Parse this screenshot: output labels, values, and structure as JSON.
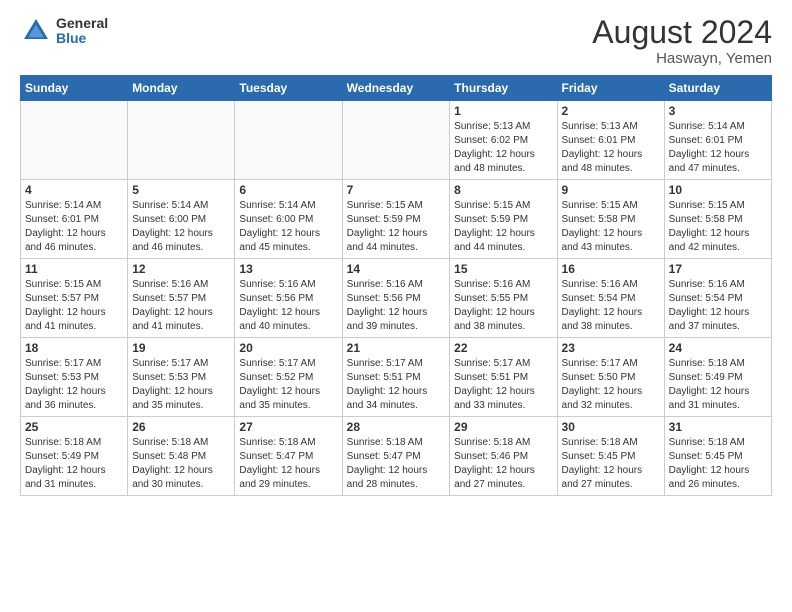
{
  "header": {
    "logo_general": "General",
    "logo_blue": "Blue",
    "main_title": "August 2024",
    "subtitle": "Haswayn, Yemen"
  },
  "calendar": {
    "days_of_week": [
      "Sunday",
      "Monday",
      "Tuesday",
      "Wednesday",
      "Thursday",
      "Friday",
      "Saturday"
    ],
    "weeks": [
      [
        {
          "day": "",
          "info": ""
        },
        {
          "day": "",
          "info": ""
        },
        {
          "day": "",
          "info": ""
        },
        {
          "day": "",
          "info": ""
        },
        {
          "day": "1",
          "info": "Sunrise: 5:13 AM\nSunset: 6:02 PM\nDaylight: 12 hours and 48 minutes."
        },
        {
          "day": "2",
          "info": "Sunrise: 5:13 AM\nSunset: 6:01 PM\nDaylight: 12 hours and 48 minutes."
        },
        {
          "day": "3",
          "info": "Sunrise: 5:14 AM\nSunset: 6:01 PM\nDaylight: 12 hours and 47 minutes."
        }
      ],
      [
        {
          "day": "4",
          "info": "Sunrise: 5:14 AM\nSunset: 6:01 PM\nDaylight: 12 hours and 46 minutes."
        },
        {
          "day": "5",
          "info": "Sunrise: 5:14 AM\nSunset: 6:00 PM\nDaylight: 12 hours and 46 minutes."
        },
        {
          "day": "6",
          "info": "Sunrise: 5:14 AM\nSunset: 6:00 PM\nDaylight: 12 hours and 45 minutes."
        },
        {
          "day": "7",
          "info": "Sunrise: 5:15 AM\nSunset: 5:59 PM\nDaylight: 12 hours and 44 minutes."
        },
        {
          "day": "8",
          "info": "Sunrise: 5:15 AM\nSunset: 5:59 PM\nDaylight: 12 hours and 44 minutes."
        },
        {
          "day": "9",
          "info": "Sunrise: 5:15 AM\nSunset: 5:58 PM\nDaylight: 12 hours and 43 minutes."
        },
        {
          "day": "10",
          "info": "Sunrise: 5:15 AM\nSunset: 5:58 PM\nDaylight: 12 hours and 42 minutes."
        }
      ],
      [
        {
          "day": "11",
          "info": "Sunrise: 5:15 AM\nSunset: 5:57 PM\nDaylight: 12 hours and 41 minutes."
        },
        {
          "day": "12",
          "info": "Sunrise: 5:16 AM\nSunset: 5:57 PM\nDaylight: 12 hours and 41 minutes."
        },
        {
          "day": "13",
          "info": "Sunrise: 5:16 AM\nSunset: 5:56 PM\nDaylight: 12 hours and 40 minutes."
        },
        {
          "day": "14",
          "info": "Sunrise: 5:16 AM\nSunset: 5:56 PM\nDaylight: 12 hours and 39 minutes."
        },
        {
          "day": "15",
          "info": "Sunrise: 5:16 AM\nSunset: 5:55 PM\nDaylight: 12 hours and 38 minutes."
        },
        {
          "day": "16",
          "info": "Sunrise: 5:16 AM\nSunset: 5:54 PM\nDaylight: 12 hours and 38 minutes."
        },
        {
          "day": "17",
          "info": "Sunrise: 5:16 AM\nSunset: 5:54 PM\nDaylight: 12 hours and 37 minutes."
        }
      ],
      [
        {
          "day": "18",
          "info": "Sunrise: 5:17 AM\nSunset: 5:53 PM\nDaylight: 12 hours and 36 minutes."
        },
        {
          "day": "19",
          "info": "Sunrise: 5:17 AM\nSunset: 5:53 PM\nDaylight: 12 hours and 35 minutes."
        },
        {
          "day": "20",
          "info": "Sunrise: 5:17 AM\nSunset: 5:52 PM\nDaylight: 12 hours and 35 minutes."
        },
        {
          "day": "21",
          "info": "Sunrise: 5:17 AM\nSunset: 5:51 PM\nDaylight: 12 hours and 34 minutes."
        },
        {
          "day": "22",
          "info": "Sunrise: 5:17 AM\nSunset: 5:51 PM\nDaylight: 12 hours and 33 minutes."
        },
        {
          "day": "23",
          "info": "Sunrise: 5:17 AM\nSunset: 5:50 PM\nDaylight: 12 hours and 32 minutes."
        },
        {
          "day": "24",
          "info": "Sunrise: 5:18 AM\nSunset: 5:49 PM\nDaylight: 12 hours and 31 minutes."
        }
      ],
      [
        {
          "day": "25",
          "info": "Sunrise: 5:18 AM\nSunset: 5:49 PM\nDaylight: 12 hours and 31 minutes."
        },
        {
          "day": "26",
          "info": "Sunrise: 5:18 AM\nSunset: 5:48 PM\nDaylight: 12 hours and 30 minutes."
        },
        {
          "day": "27",
          "info": "Sunrise: 5:18 AM\nSunset: 5:47 PM\nDaylight: 12 hours and 29 minutes."
        },
        {
          "day": "28",
          "info": "Sunrise: 5:18 AM\nSunset: 5:47 PM\nDaylight: 12 hours and 28 minutes."
        },
        {
          "day": "29",
          "info": "Sunrise: 5:18 AM\nSunset: 5:46 PM\nDaylight: 12 hours and 27 minutes."
        },
        {
          "day": "30",
          "info": "Sunrise: 5:18 AM\nSunset: 5:45 PM\nDaylight: 12 hours and 27 minutes."
        },
        {
          "day": "31",
          "info": "Sunrise: 5:18 AM\nSunset: 5:45 PM\nDaylight: 12 hours and 26 minutes."
        }
      ]
    ]
  }
}
